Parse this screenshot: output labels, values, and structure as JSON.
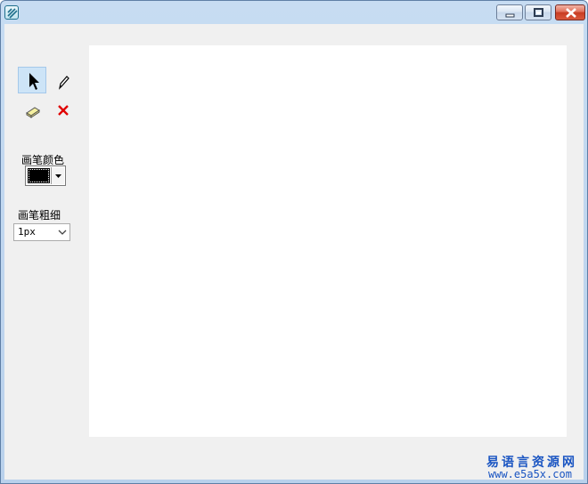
{
  "window": {
    "title": "",
    "icon": "app-logo-icon",
    "controls": [
      "minimize-icon",
      "maximize-icon",
      "close-icon"
    ]
  },
  "toolbox": {
    "tools": [
      {
        "name": "select",
        "icon": "arrow-pointer-icon",
        "selected": true
      },
      {
        "name": "pencil",
        "icon": "pencil-icon",
        "selected": false
      },
      {
        "name": "eraser",
        "icon": "eraser-icon",
        "selected": false
      },
      {
        "name": "clear",
        "icon": "red-x-icon",
        "selected": false
      }
    ]
  },
  "pen_color": {
    "label": "画笔颜色",
    "value": "#000000"
  },
  "pen_width": {
    "label": "画笔粗细",
    "value": "1px"
  },
  "watermark": {
    "line1": "易语言资源网",
    "line2": "www.e5a5x.com"
  },
  "colors": {
    "selected_tool_bg": "#cde4f7",
    "client_bg": "#f0f0f0",
    "canvas_bg": "#ffffff",
    "watermark": "#1a55c2",
    "clear_icon": "#e00000"
  }
}
